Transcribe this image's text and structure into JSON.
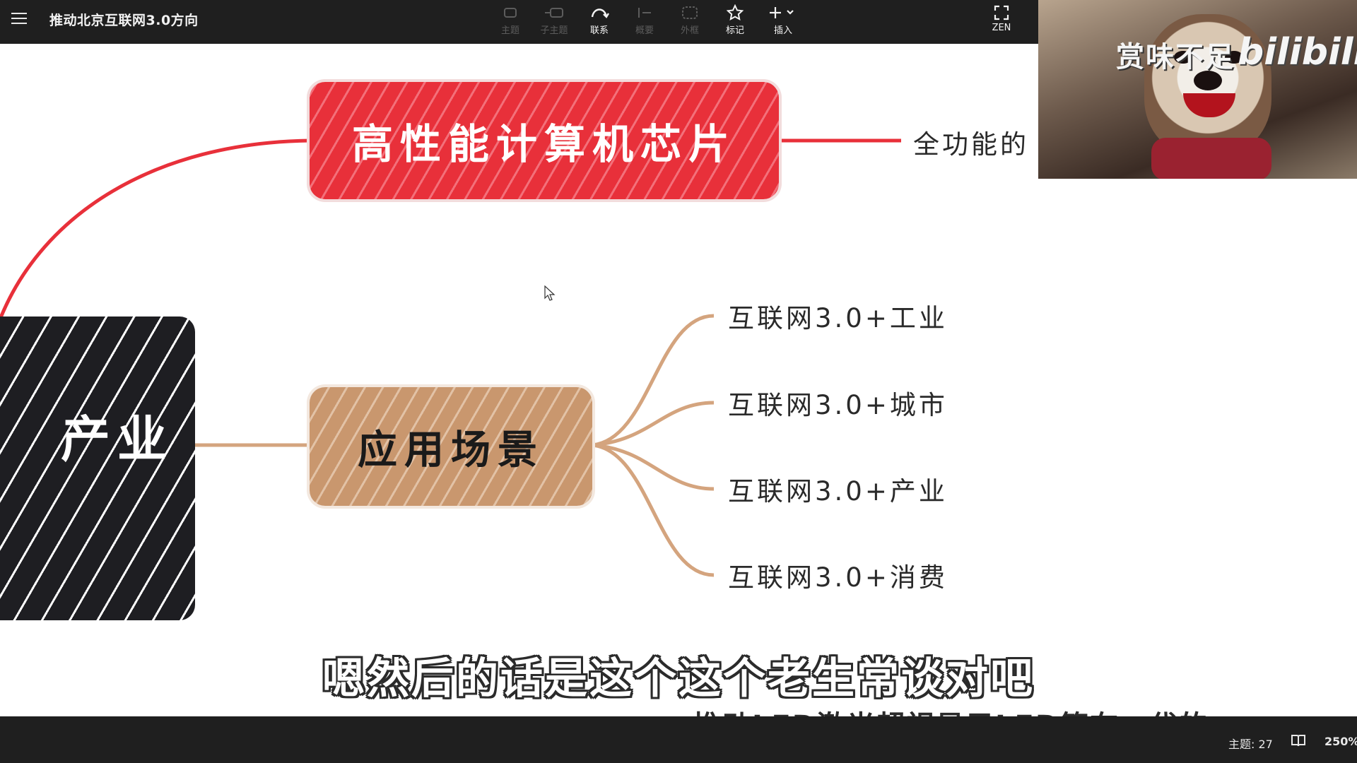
{
  "toolbar": {
    "title": "推动北京互联网3.0方向",
    "tools": [
      {
        "label": "主题",
        "icon": "topic-icon",
        "enabled": false
      },
      {
        "label": "子主题",
        "icon": "subtopic-icon",
        "enabled": false
      },
      {
        "label": "联系",
        "icon": "relationship-icon",
        "enabled": true
      },
      {
        "label": "概要",
        "icon": "summary-icon",
        "enabled": false
      },
      {
        "label": "外框",
        "icon": "boundary-icon",
        "enabled": false
      },
      {
        "label": "标记",
        "icon": "star-icon",
        "enabled": true
      },
      {
        "label": "插入",
        "icon": "plus-icon",
        "enabled": true
      },
      {
        "label": "ZEN",
        "icon": "fullscreen-icon",
        "enabled": true
      }
    ]
  },
  "mindmap": {
    "root_label": "产业",
    "nodes": {
      "chip": {
        "label": "高性能计算机芯片",
        "color": "#e8303a"
      },
      "scenario": {
        "label": "应用场景",
        "color": "#c9976e"
      }
    },
    "chip_child": "全功能的",
    "scenario_children": [
      "互联网3.0+工业",
      "互联网3.0+城市",
      "互联网3.0+产业",
      "互联网3.0+消费"
    ]
  },
  "webcam": {
    "banner": "赏味不足",
    "logo": "bilibili"
  },
  "subtitle": {
    "line1": "嗯然后的话是这个这个老生常谈对吧",
    "line2": "推动LED激光超视显示LED等在一代的"
  },
  "statusbar": {
    "topics": "主题: 27",
    "zoom": "250%"
  }
}
